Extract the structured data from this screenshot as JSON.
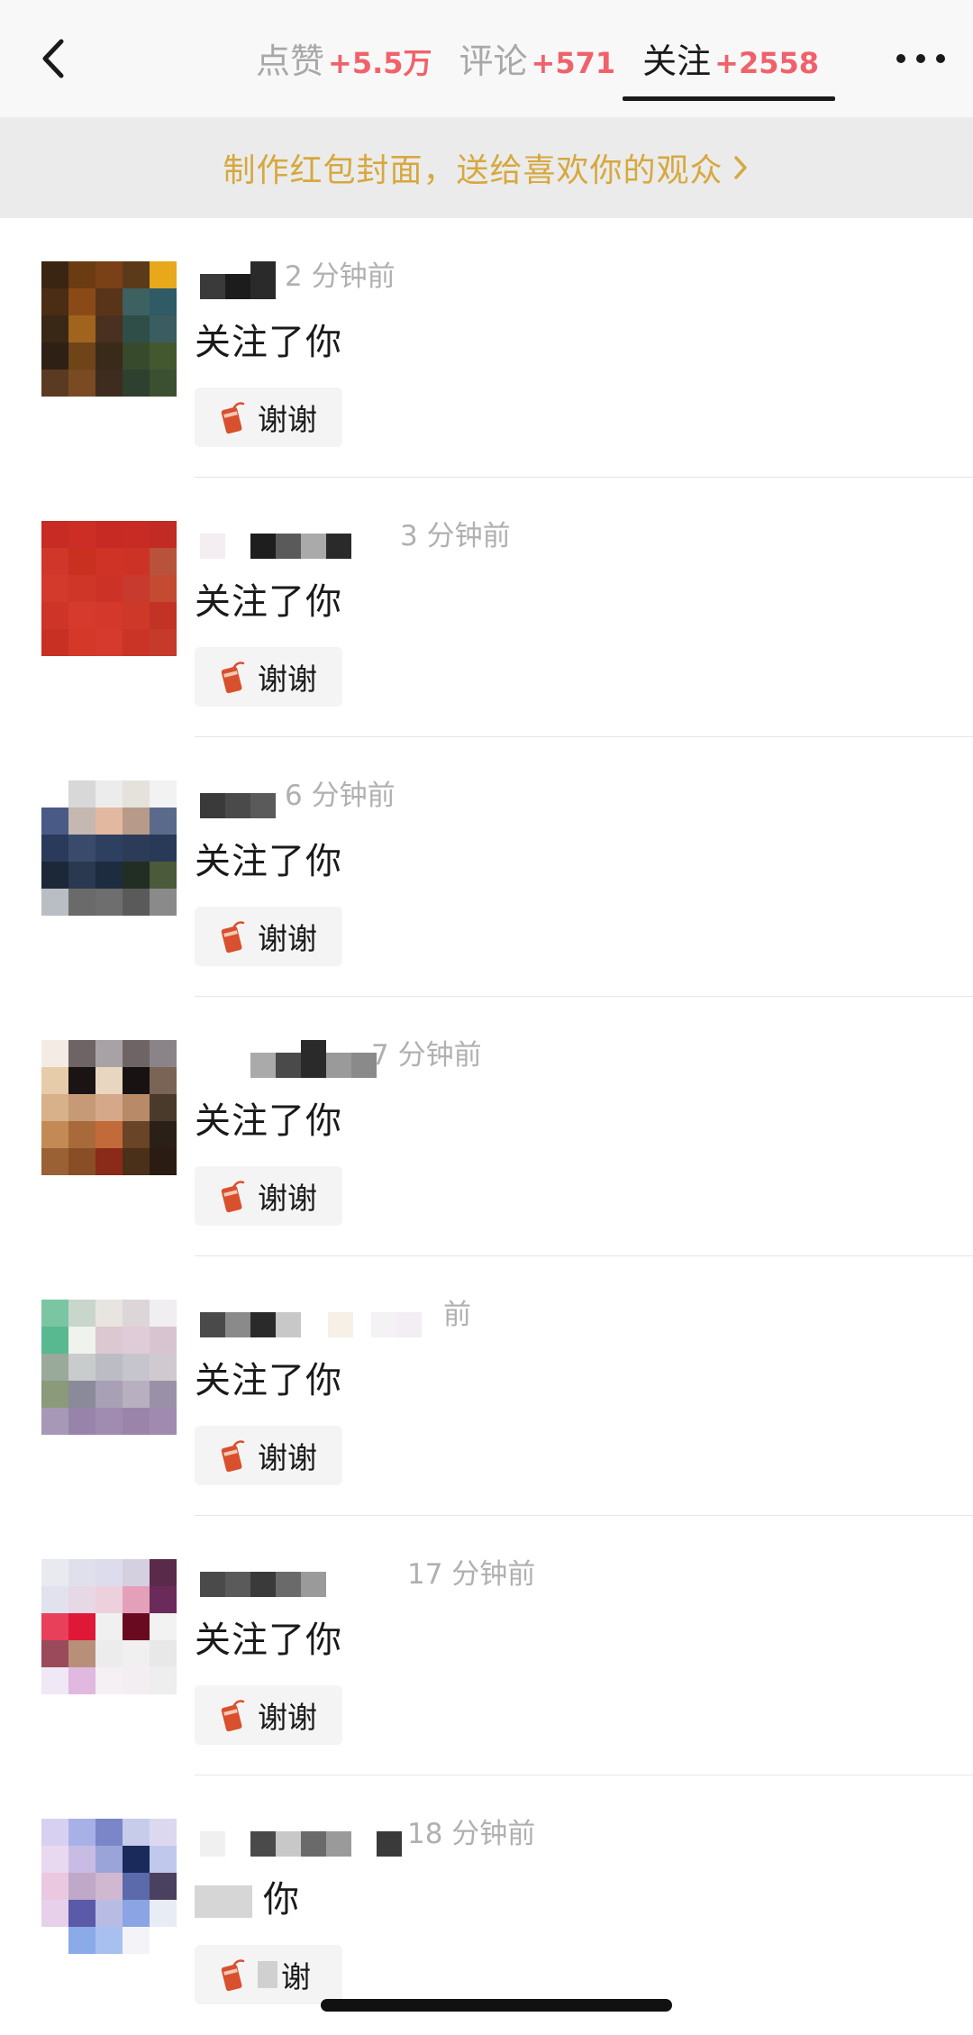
{
  "header": {
    "tabs": [
      {
        "label": "点赞",
        "count": "+5.5万",
        "active": false
      },
      {
        "label": "评论",
        "count": "+571",
        "active": false
      },
      {
        "label": "关注",
        "count": "+2558",
        "active": true
      }
    ],
    "back_icon": "chevron-left-icon",
    "more_icon": "more-dots-icon"
  },
  "banner": {
    "text": "制作红包封面，送给喜欢你的观众",
    "arrow_icon": "chevron-right-icon"
  },
  "notifications": [
    {
      "time": "2 分钟前",
      "message": "关注了你",
      "button": "谢谢"
    },
    {
      "time": "3 分钟前",
      "message": "关注了你",
      "button": "谢谢"
    },
    {
      "time": "6 分钟前",
      "message": "关注了你",
      "button": "谢谢"
    },
    {
      "time": "7 分钟前",
      "message": "关注了你",
      "button": "谢谢"
    },
    {
      "time": "前",
      "message": "关注了你",
      "button": "谢谢"
    },
    {
      "time": "17 分钟前",
      "message": "关注了你",
      "button": "谢谢"
    },
    {
      "time": "18 分钟前",
      "message": "你",
      "button": "谢"
    }
  ],
  "colors": {
    "tab_count": "#f0626a",
    "banner_text": "#d6a83e",
    "banner_bg": "#ebebeb",
    "time_text": "#b0b0b0",
    "button_bg": "#f4f4f4",
    "thanks_icon": "#d9502f"
  }
}
